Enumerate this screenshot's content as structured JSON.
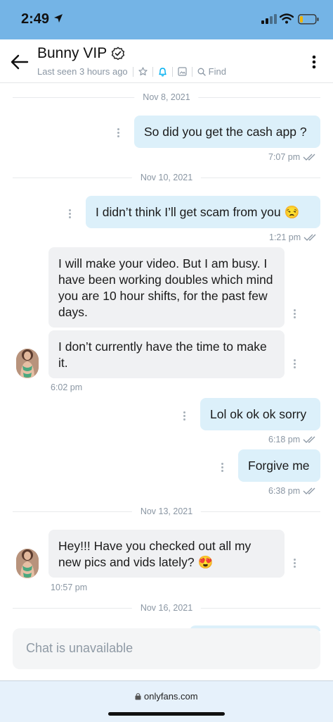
{
  "status_bar": {
    "time": "2:49"
  },
  "header": {
    "title": "Bunny VIP",
    "last_seen": "Last seen 3 hours ago",
    "find_label": "Find"
  },
  "messages": {
    "d1": "Nov 8, 2021",
    "m1": {
      "text": "So did you get the cash app ?",
      "time": "7:07 pm"
    },
    "d2": "Nov 10, 2021",
    "m2": {
      "text": "I didn’t think I’ll get scam from you 😒",
      "time": "1:21 pm"
    },
    "m3": {
      "text": "I will make your video. But I am busy. I have been working doubles which mind you are 10 hour shifts, for the past few days."
    },
    "m4": {
      "text": "I don’t currently have the time to make it.",
      "time": "6:02 pm"
    },
    "m5": {
      "text": "Lol ok ok ok sorry",
      "time": "6:18 pm"
    },
    "m6": {
      "text": "Forgive me",
      "time": "6:38 pm"
    },
    "d3": "Nov 13, 2021",
    "m7": {
      "text": "Hey!!! Have you checked out all my new pics and vids lately? 😍",
      "time": "10:57 pm"
    },
    "d4": "Nov 16, 2021"
  },
  "composer": {
    "placeholder": "Chat is unavailable"
  },
  "browser": {
    "url": "onlyfans.com"
  },
  "colors": {
    "status_bar_bg": "#74b4e6",
    "outgoing_bubble": "#dcf0fa",
    "incoming_bubble": "#f0f1f3",
    "accent": "#00aff0"
  },
  "icons": [
    "location-arrow-icon",
    "signal-icon",
    "wifi-icon",
    "battery-icon",
    "back-arrow-icon",
    "verified-icon",
    "star-icon",
    "bell-icon",
    "image-icon",
    "search-icon",
    "more-vertical-icon",
    "double-check-icon",
    "lock-icon"
  ]
}
